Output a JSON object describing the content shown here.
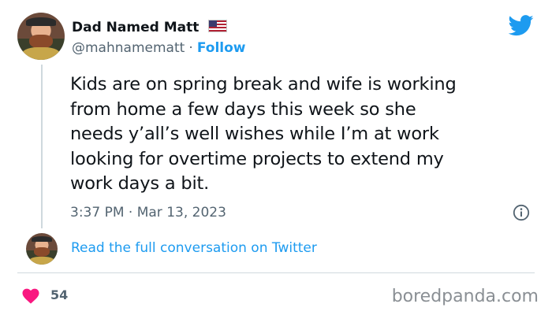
{
  "author": {
    "display_name": "Dad Named Matt",
    "flag": "🇺🇸",
    "handle": "@mahnamematt",
    "separator": "·",
    "follow_label": "Follow"
  },
  "tweet": {
    "text": "Kids are on spring break and wife is working\nfrom home a few days this week so she\nneeds y’all’s well wishes while I’m at work\nlooking for overtime projects to extend my\nwork days a bit.",
    "timestamp": "3:37 PM · Mar 13, 2023"
  },
  "conversation": {
    "link_label": "Read the full conversation on Twitter"
  },
  "engagement": {
    "likes": "54"
  },
  "watermark": "boredpanda.com",
  "colors": {
    "accent": "#1d9bf0",
    "like": "#f91880",
    "muted": "#536471"
  },
  "icons": {
    "brand": "twitter-bird-icon",
    "info": "info-icon",
    "like": "heart-icon"
  }
}
